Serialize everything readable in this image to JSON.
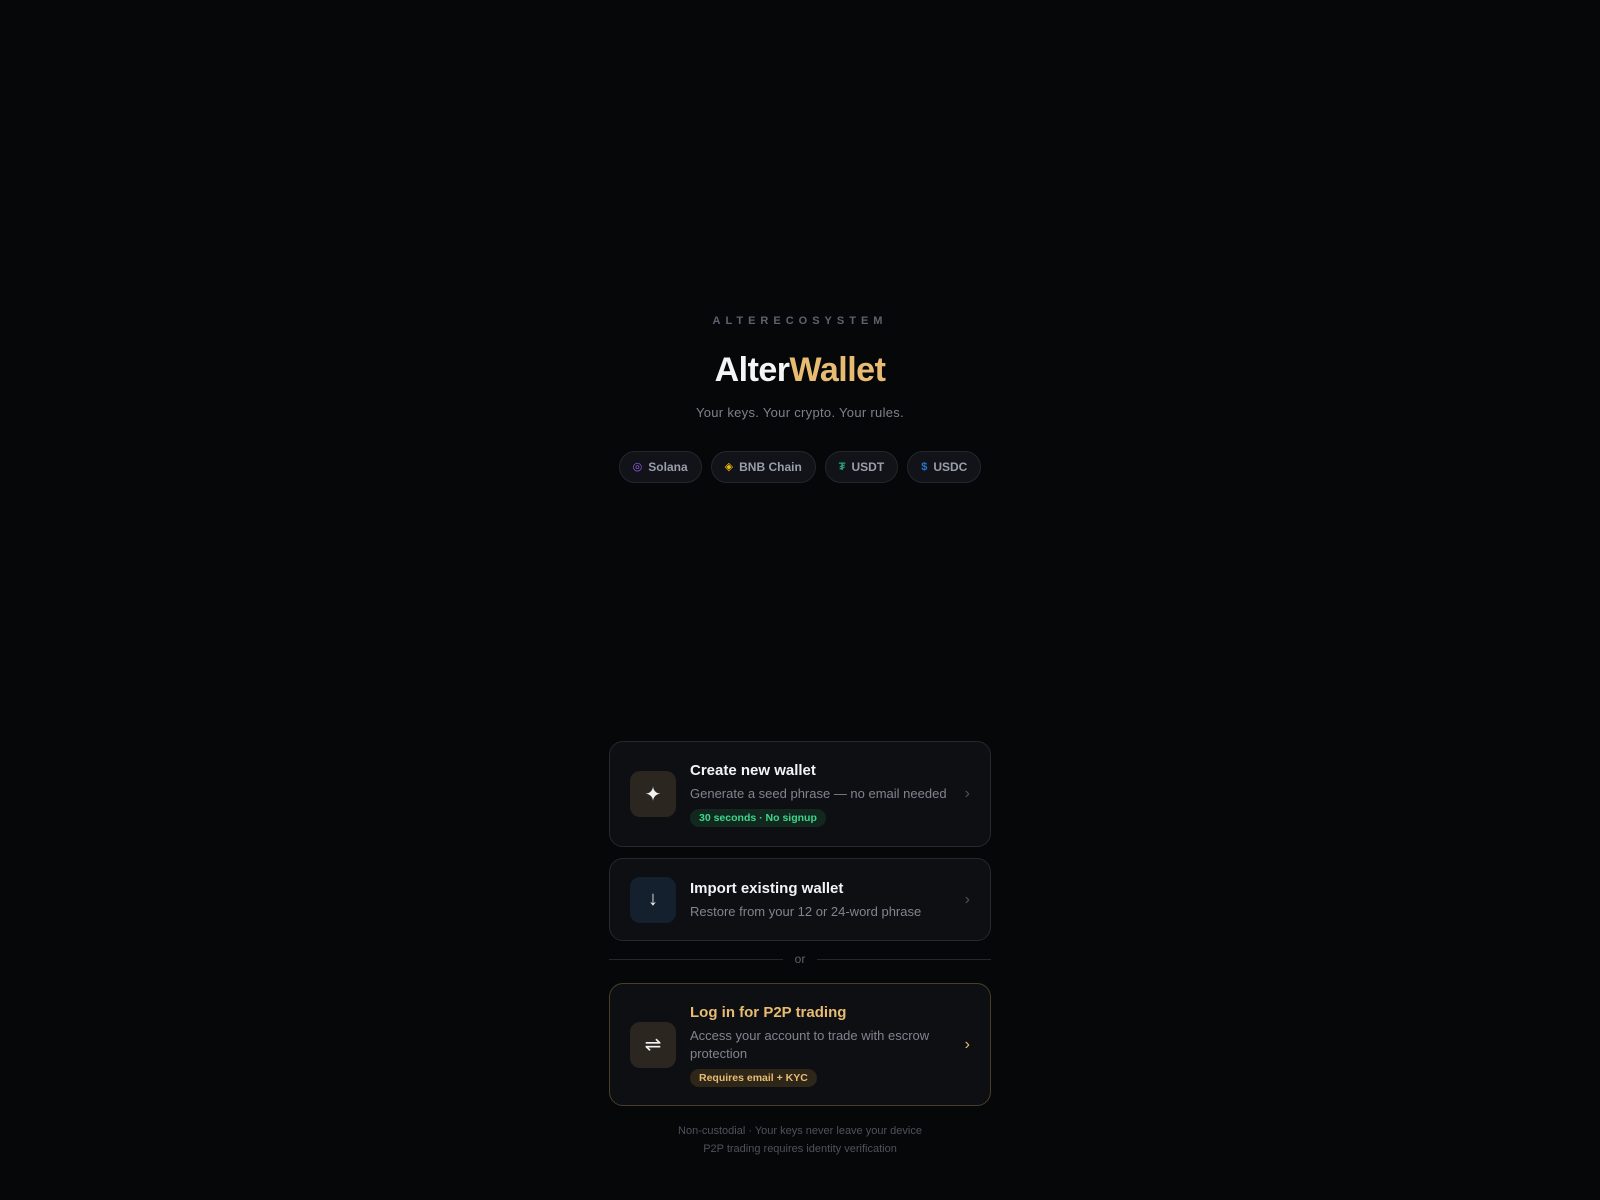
{
  "header": {
    "eyebrow": "ALTERECOSYSTEM",
    "brand_part1": "Alter",
    "brand_part2": "Wallet",
    "tagline": "Your keys. Your crypto. Your rules."
  },
  "chips": [
    {
      "label": "Solana",
      "icon": "solana-icon",
      "glyph": "◎",
      "color": "#9b5cf5"
    },
    {
      "label": "BNB Chain",
      "icon": "bnb-icon",
      "glyph": "◈",
      "color": "#f0b90b"
    },
    {
      "label": "USDT",
      "icon": "tether-icon",
      "glyph": "₮",
      "color": "#26a17b"
    },
    {
      "label": "USDC",
      "icon": "usdc-icon",
      "glyph": "$",
      "color": "#2775ca"
    }
  ],
  "cards": {
    "create": {
      "title": "Create new wallet",
      "desc": "Generate a seed phrase — no email needed",
      "badge": "30 seconds · No signup",
      "icon": "sparkle-icon",
      "glyph": "✦"
    },
    "import": {
      "title": "Import existing wallet",
      "desc": "Restore from your 12 or 24-word phrase",
      "icon": "arrow-down-icon",
      "glyph": "↓"
    },
    "p2p": {
      "title": "Log in for P2P trading",
      "desc": "Access your account to trade with escrow protection",
      "badge": "Requires email + KYC",
      "icon": "swap-arrows-icon",
      "glyph": "⇌"
    }
  },
  "divider_text": "or",
  "footer": {
    "line1": "Non-custodial · Your keys never leave your device",
    "line2": "P2P trading requires identity verification"
  },
  "colors": {
    "background": "#060709",
    "accent_gold": "#e7bc72",
    "accent_green": "#3dd68c"
  }
}
